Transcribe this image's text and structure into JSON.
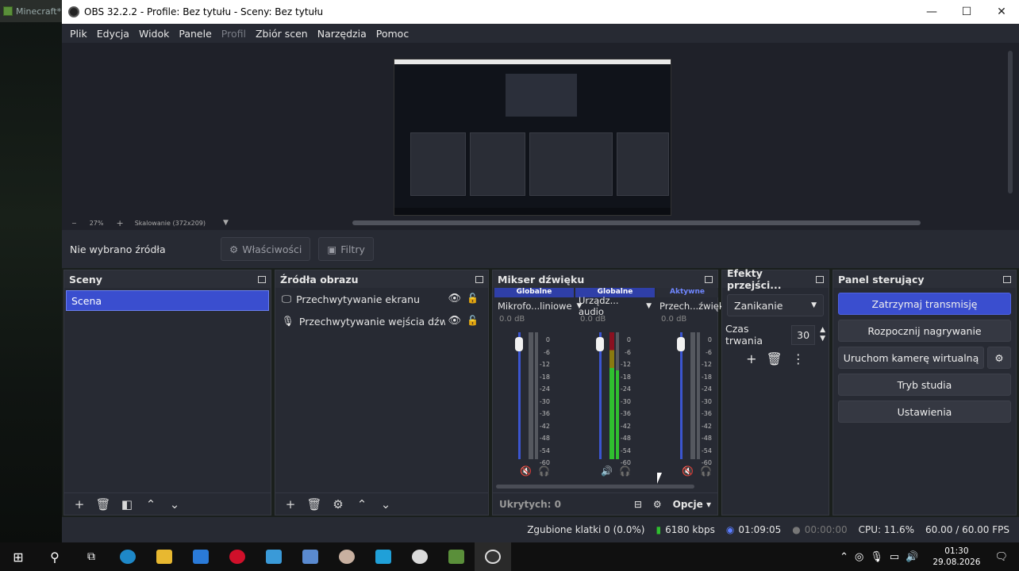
{
  "background_tab": {
    "label": "Minecraft*"
  },
  "window": {
    "title": "OBS 32.2.2 - Profile: Bez tytułu - Sceny: Bez tytułu",
    "minimize": "—",
    "maximize": "☐",
    "close": "✕"
  },
  "menu": [
    "Plik",
    "Edycja",
    "Widok",
    "Panele",
    "Profil",
    "Zbiór scen",
    "Narzędzia",
    "Pomoc"
  ],
  "zoom": {
    "minus": "−",
    "level": "27%",
    "plus": "+",
    "scaling": "Skalowanie (372x209)"
  },
  "context_bar": {
    "no_source": "Nie wybrano źródła",
    "properties": "Właściwości",
    "filters": "Filtry"
  },
  "scenes": {
    "title": "Sceny",
    "items": [
      "Scena"
    ]
  },
  "sources": {
    "title": "Źródła obrazu",
    "items": [
      "Przechwytywanie ekranu",
      "Przechwytywanie wejścia dźwięku"
    ]
  },
  "mixer": {
    "title": "Mikser dźwięku",
    "channels": [
      {
        "tag": "Globalne",
        "name": "Mikrofo...liniowe",
        "db": "0.0 dB"
      },
      {
        "tag": "Globalne",
        "name": "Urządz... audio",
        "db": "0.0 dB"
      },
      {
        "tag": "Aktywne",
        "name": "Przech...źwięku",
        "db": "0.0 dB"
      }
    ],
    "scale": [
      "0",
      "-6",
      "-12",
      "-18",
      "-24",
      "-30",
      "-36",
      "-42",
      "-48",
      "-54",
      "-60"
    ],
    "hidden": "Ukrytych: 0",
    "options": "Opcje"
  },
  "transitions": {
    "title": "Efekty przejści...",
    "selected": "Zanikanie",
    "duration_label": "Czas trwania",
    "duration": "30"
  },
  "controls": {
    "title": "Panel sterujący",
    "stop_stream": "Zatrzymaj transmisję",
    "start_record": "Rozpocznij nagrywanie",
    "virtual_cam": "Uruchom kamerę wirtualną",
    "studio_mode": "Tryb studia",
    "settings": "Ustawienia"
  },
  "status": {
    "dropped": "Zgubione klatki 0 (0.0%)",
    "bitrate": "6180 kbps",
    "stream_time": "01:09:05",
    "rec_time": "00:00:00",
    "cpu": "CPU: 11.6%",
    "fps": "60.00 / 60.00 FPS"
  },
  "taskbar": {
    "time": "01:30",
    "date": "29.08.2026"
  },
  "colors": {
    "accent": "#3a4ecf",
    "panel": "#272a33",
    "preview": "#1f2129"
  }
}
